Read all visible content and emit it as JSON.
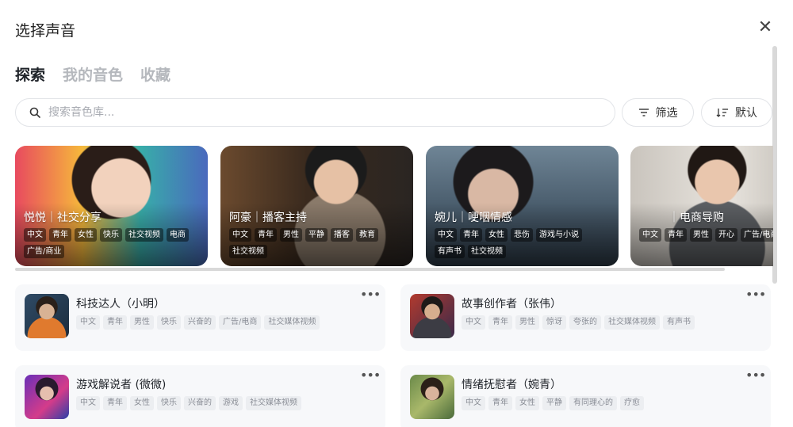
{
  "dialog": {
    "title": "选择声音",
    "close_icon": "close-icon"
  },
  "tabs": [
    {
      "label": "探索",
      "active": true
    },
    {
      "label": "我的音色",
      "active": false
    },
    {
      "label": "收藏",
      "active": false
    }
  ],
  "search": {
    "placeholder": "搜索音色库..."
  },
  "filter_button": {
    "label": "筛选"
  },
  "sort_button": {
    "label": "默认"
  },
  "featured": [
    {
      "name": "悦悦｜社交分享",
      "tags": [
        "中文",
        "青年",
        "女性",
        "快乐",
        "社交视频",
        "电商",
        "广告/商业"
      ]
    },
    {
      "name": "阿豪｜播客主持",
      "tags": [
        "中文",
        "青年",
        "男性",
        "平静",
        "播客",
        "教育",
        "社交视频"
      ]
    },
    {
      "name": "婉儿｜哽咽情感",
      "tags": [
        "中文",
        "青年",
        "女性",
        "悲伤",
        "游戏与小说",
        "有声书",
        "社交视频"
      ]
    },
    {
      "name": "｜电商导购",
      "tags": [
        "中文",
        "青年",
        "男性",
        "开心",
        "广告/电商"
      ]
    }
  ],
  "voices": [
    {
      "name": "科技达人（小明）",
      "tags": [
        "中文",
        "青年",
        "男性",
        "快乐",
        "兴奋的",
        "广告/电商",
        "社交媒体视频"
      ]
    },
    {
      "name": "故事创作者（张伟）",
      "tags": [
        "中文",
        "青年",
        "男性",
        "惊讶",
        "夸张的",
        "社交媒体视频",
        "有声书"
      ]
    },
    {
      "name": "游戏解说者 (微微)",
      "tags": [
        "中文",
        "青年",
        "女性",
        "快乐",
        "兴奋的",
        "游戏",
        "社交媒体视频"
      ]
    },
    {
      "name": "情绪抚慰者（婉青）",
      "tags": [
        "中文",
        "青年",
        "女性",
        "平静",
        "有同理心的",
        "疗愈"
      ]
    }
  ]
}
